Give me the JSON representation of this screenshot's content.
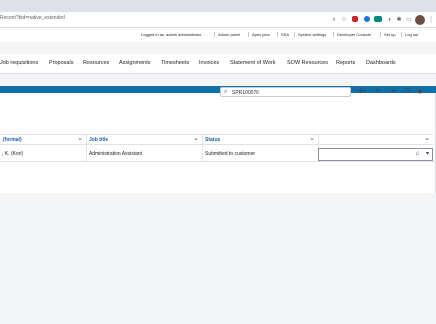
{
  "browser": {
    "url": "Recent?bid=native_extended"
  },
  "utility_nav": {
    "links": [
      "Logged in as: admin administrator",
      "Admin panel",
      "Apex jobs",
      "SSA",
      "System settings",
      "Developer Console",
      "Set up",
      "Log out"
    ]
  },
  "main_nav": {
    "items": [
      "Job requisitions",
      "Proposals",
      "Resources",
      "Assignments",
      "Timesheets",
      "Invoices",
      "Statement of Work",
      "SOW Resources",
      "Reports",
      "Dashboards"
    ]
  },
  "toolbar": {
    "search_value": "SPR100076"
  },
  "table": {
    "columns": [
      "(formal)",
      "Job title",
      "Status",
      ""
    ],
    "rows": [
      {
        "name": ", K. (Kori)",
        "job_title": "Administration Assistant",
        "status": "Submitted to customer"
      }
    ]
  },
  "colors": {
    "nav_band": "#0f6fa8",
    "header_text": "#1a5fa8"
  }
}
